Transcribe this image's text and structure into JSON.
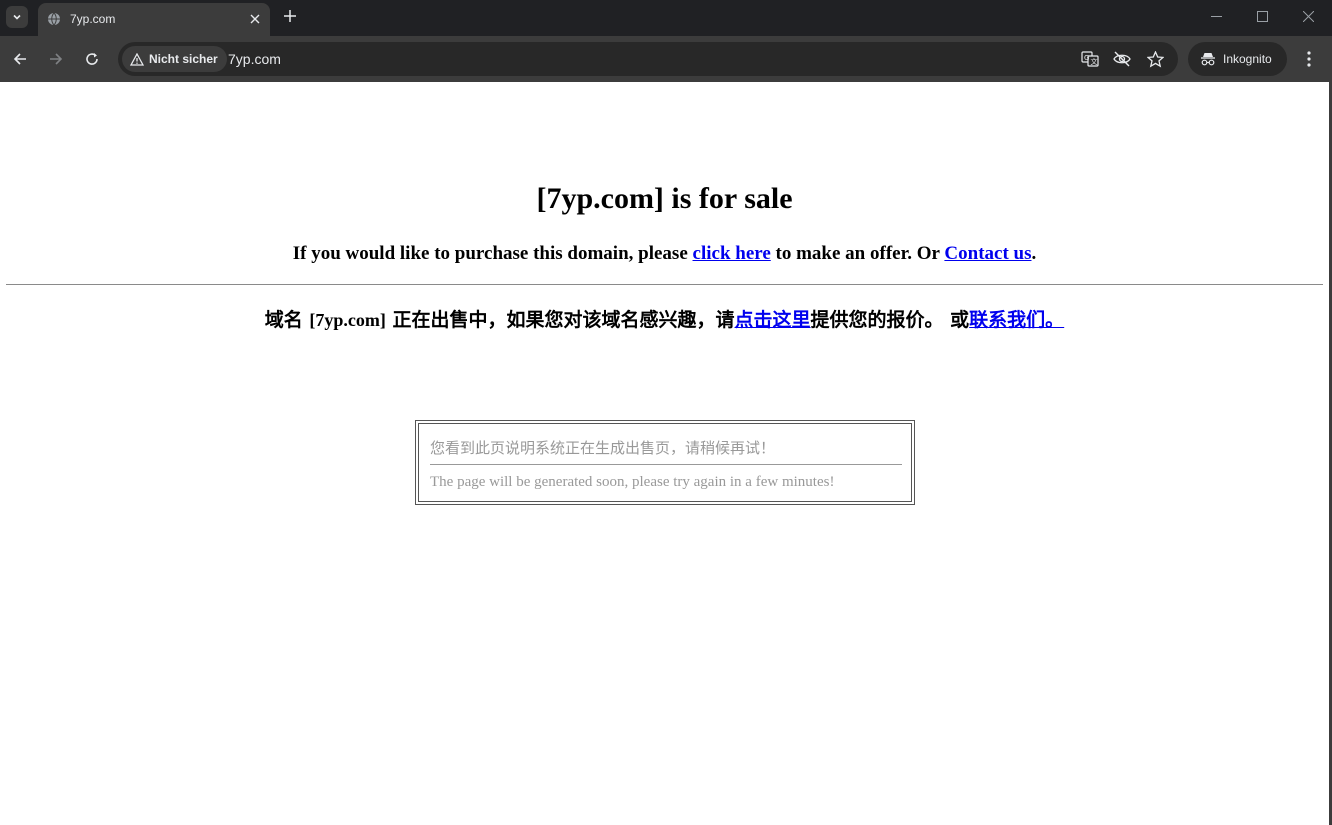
{
  "browser": {
    "tab_title": "7yp.com",
    "security_label": "Nicht sicher",
    "url": "7yp.com",
    "incognito_label": "Inkognito",
    "icons": [
      "tab-search-icon",
      "globe-icon",
      "close-icon",
      "plus-icon",
      "minimize-icon",
      "maximize-icon",
      "close-window-icon",
      "back-icon",
      "forward-icon",
      "reload-icon",
      "warning-icon",
      "translate-icon",
      "eye-off-icon",
      "star-icon",
      "incognito-icon",
      "kebab-menu-icon"
    ]
  },
  "page": {
    "headline": "[7yp.com] is for sale",
    "offer_prefix": "If you would like to purchase this domain, please ",
    "offer_link": "click here",
    "offer_middle": " to make an offer. Or ",
    "contact_link": "Contact us",
    "offer_suffix": ".",
    "cn_prefix": "域名 ",
    "cn_domain": "[7yp.com]",
    "cn_middle": " 正在出售中，如果您对该域名感兴趣，请",
    "cn_link": "点击这里",
    "cn_after_link": "提供您的报价。 或",
    "cn_contact_link": "联系我们。",
    "notice_cn": "您看到此页说明系统正在生成出售页，请稍候再试！",
    "notice_en": "The page will be generated soon, please try again in a few minutes!"
  },
  "colors": {
    "link": "#0000ee",
    "notice_text": "#999999",
    "chrome_dark": "#202124",
    "chrome_toolbar": "#3c3c3c"
  }
}
